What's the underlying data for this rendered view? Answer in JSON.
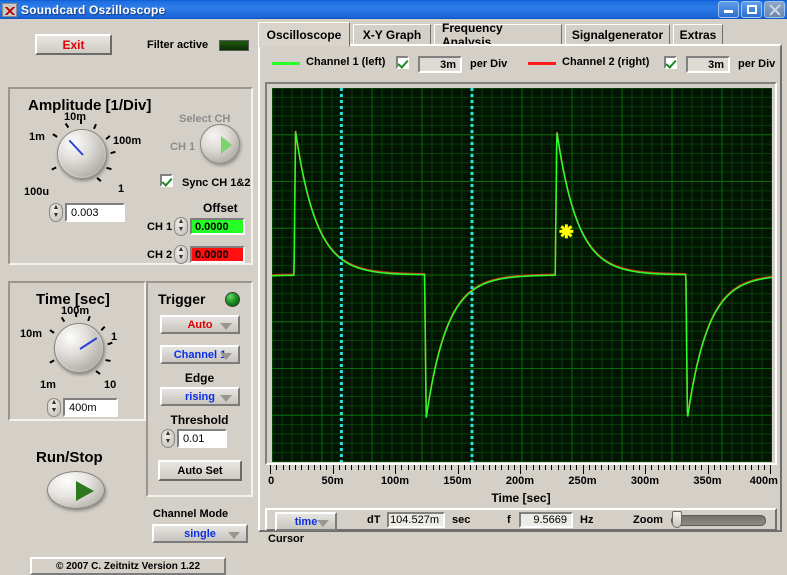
{
  "window": {
    "title": "Soundcard Oszilloscope",
    "icon": "waveform-icon",
    "minimize": "–",
    "maximize": "□",
    "close": "✕"
  },
  "toolbar": {
    "exit_label": "Exit",
    "filter_label": "Filter active",
    "filter_led_state": "on"
  },
  "tabs": [
    {
      "label": "Oscilloscope",
      "active": true
    },
    {
      "label": "X-Y Graph",
      "active": false
    },
    {
      "label": "Frequency Analysis",
      "active": false
    },
    {
      "label": "Signalgenerator",
      "active": false
    },
    {
      "label": "Extras",
      "active": false
    }
  ],
  "channels": [
    {
      "name": "Channel 1 (left)",
      "color": "#2aff2a",
      "enabled": true,
      "per_div_value": "3m",
      "per_div_label": "per Div"
    },
    {
      "name": "Channel 2 (right)",
      "color": "#ff1a1a",
      "enabled": true,
      "per_div_value": "3m",
      "per_div_label": "per Div"
    }
  ],
  "amplitude": {
    "title": "Amplitude [1/Div]",
    "knob_labels": [
      "10m",
      "1m",
      "100m",
      "100u",
      "1"
    ],
    "value": "0.003",
    "select_ch_label": "Select CH",
    "ch_selected": "CH 1",
    "sync_label": "Sync CH 1&2",
    "sync_checked": true,
    "offset_label": "Offset",
    "offsets": [
      {
        "label": "CH 1",
        "value": "0.0000",
        "color": "#26ff26"
      },
      {
        "label": "CH 2",
        "value": "0.0000",
        "color": "#ff0f0f"
      }
    ]
  },
  "time": {
    "title": "Time [sec]",
    "knob_labels": [
      "100m",
      "10m",
      "1",
      "1m",
      "10"
    ],
    "value": "400m"
  },
  "trigger": {
    "title": "Trigger",
    "led_state": "on",
    "mode": "Auto",
    "source": "Channel 1",
    "edge_label": "Edge",
    "edge": "rising",
    "threshold_label": "Threshold",
    "threshold": "0.01",
    "auto_set_label": "Auto Set"
  },
  "run": {
    "label": "Run/Stop",
    "state": "running"
  },
  "channel_mode": {
    "label": "Channel Mode",
    "value": "single"
  },
  "copyright": "© 2007   C. Zeitnitz Version 1.22",
  "status": {
    "cursor_label": "Cursor",
    "cursor_mode": "time",
    "dt_label": "dT",
    "dt_value": "104.527m",
    "dt_unit": "sec",
    "f_label": "f",
    "f_value": "9.5669",
    "f_unit": "Hz",
    "zoom_label": "Zoom",
    "zoom_percent": 2
  },
  "chart_data": {
    "type": "line",
    "title": "",
    "xlabel": "Time [sec]",
    "ylabel": "",
    "xlim": [
      0,
      0.4
    ],
    "ylim": [
      -0.012,
      0.012
    ],
    "grid": true,
    "background": "#021502",
    "grid_color": "#0b6b0b",
    "xticks": [
      0,
      0.05,
      0.1,
      0.15,
      0.2,
      0.25,
      0.3,
      0.35,
      0.4
    ],
    "xtick_labels": [
      "0",
      "50m",
      "100m",
      "150m",
      "200m",
      "250m",
      "300m",
      "350m",
      "400m"
    ],
    "period_sec": 0.1045,
    "waveform": "exponential-decay-sawtooth",
    "series": [
      {
        "name": "Channel 1 (left)",
        "color": "#2aff2a"
      },
      {
        "name": "Channel 2 (right)",
        "color": "#d03820"
      }
    ],
    "cursors": [
      {
        "name": "cursor-1",
        "type": "vertical",
        "x": 0.0555,
        "color": "#30e0e0"
      },
      {
        "name": "cursor-2",
        "type": "vertical",
        "x": 0.16,
        "color": "#30e0e0"
      }
    ],
    "markers": [
      {
        "name": "cursor-point",
        "x": 0.2355,
        "y": 0.0028,
        "color": "#ffff00",
        "glyph": "cross"
      }
    ]
  }
}
